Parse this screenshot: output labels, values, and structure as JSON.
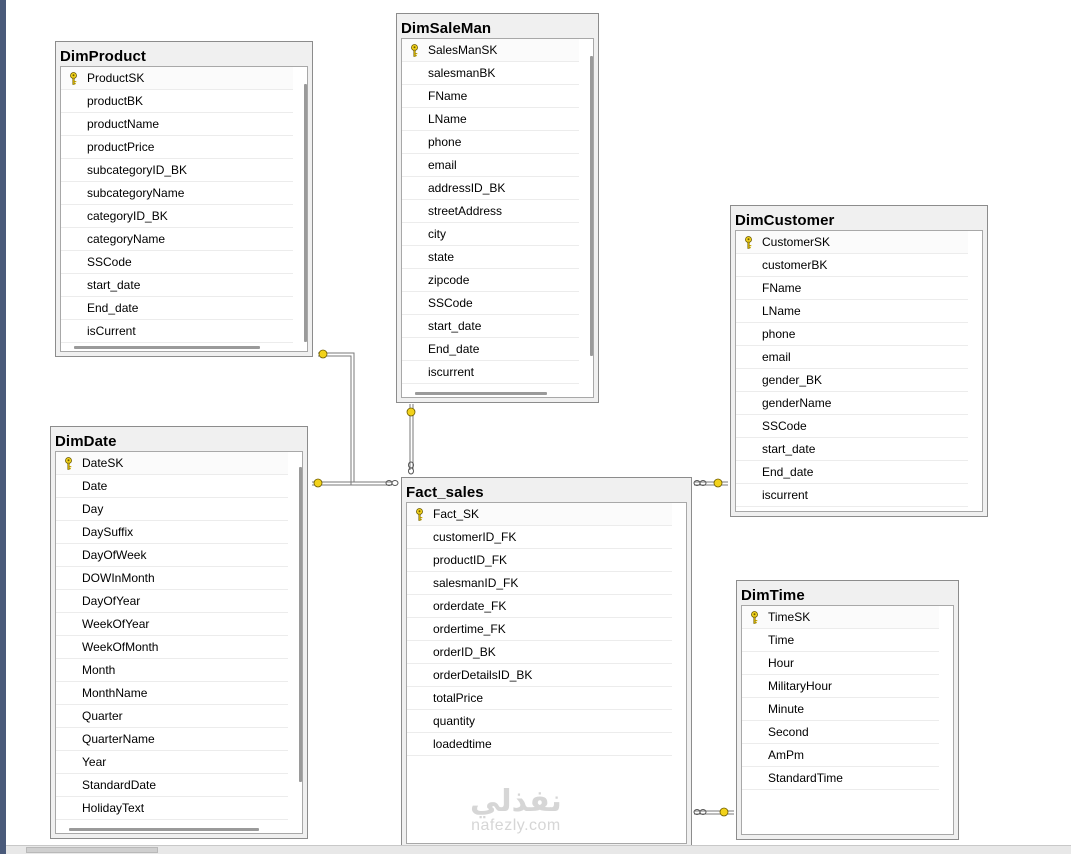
{
  "tables": {
    "dim_product": {
      "title": "DimProduct",
      "columns": [
        "ProductSK",
        "productBK",
        "productName",
        "productPrice",
        "subcategoryID_BK",
        "subcategoryName",
        "categoryID_BK",
        "categoryName",
        "SSCode",
        "start_date",
        "End_date",
        "isCurrent"
      ]
    },
    "dim_saleman": {
      "title": "DimSaleMan",
      "columns": [
        "SalesManSK",
        "salesmanBK",
        "FName",
        "LName",
        "phone",
        "email",
        "addressID_BK",
        "streetAddress",
        "city",
        "state",
        "zipcode",
        "SSCode",
        "start_date",
        "End_date",
        "iscurrent"
      ]
    },
    "dim_customer": {
      "title": "DimCustomer",
      "columns": [
        "CustomerSK",
        "customerBK",
        "FName",
        "LName",
        "phone",
        "email",
        "gender_BK",
        "genderName",
        "SSCode",
        "start_date",
        "End_date",
        "iscurrent"
      ]
    },
    "dim_date": {
      "title": "DimDate",
      "columns": [
        "DateSK",
        "Date",
        "Day",
        "DaySuffix",
        "DayOfWeek",
        "DOWInMonth",
        "DayOfYear",
        "WeekOfYear",
        "WeekOfMonth",
        "Month",
        "MonthName",
        "Quarter",
        "QuarterName",
        "Year",
        "StandardDate",
        "HolidayText"
      ]
    },
    "fact_sales": {
      "title": "Fact_sales",
      "columns": [
        "Fact_SK",
        "customerID_FK",
        "productID_FK",
        "salesmanID_FK",
        "orderdate_FK",
        "ordertime_FK",
        "orderID_BK",
        "orderDetailsID_BK",
        "totalPrice",
        "quantity",
        "loadedtime"
      ]
    },
    "dim_time": {
      "title": "DimTime",
      "columns": [
        "TimeSK",
        "Time",
        "Hour",
        "MilitaryHour",
        "Minute",
        "Second",
        "AmPm",
        "StandardTime"
      ]
    }
  },
  "watermark": {
    "arabic": "نفذلي",
    "latin": "nafezly.com"
  },
  "colors": {
    "key": "#f2d21a",
    "line": "#7a7a7a",
    "frame": "#8c8c8c"
  }
}
